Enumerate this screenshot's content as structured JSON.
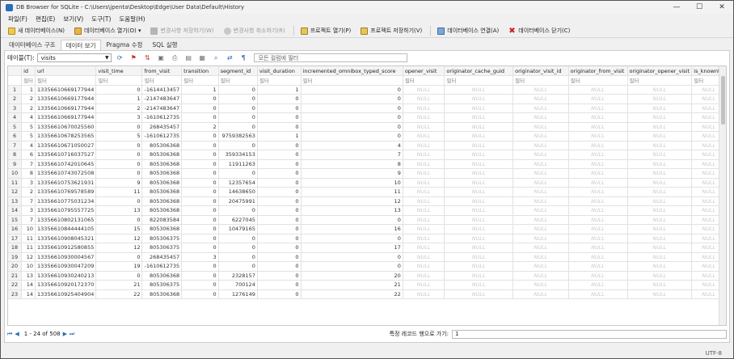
{
  "window": {
    "title": "DB Browser for SQLite - C:\\Users\\jpenta\\Desktop\\Edge\\User Data\\Default\\History",
    "minimize": "—",
    "maximize": "☐",
    "close": "✕"
  },
  "menu": [
    "파일(F)",
    "편집(E)",
    "보기(V)",
    "도구(T)",
    "도움말(H)"
  ],
  "toolbar": {
    "new_db": "새 데이터베이스(N)",
    "open_db": "데이터베이스 열기(O)",
    "write_changes": "변경사항 저장하기(W)",
    "revert_changes": "변경사항 취소하기(R)",
    "open_project": "프로젝트 열기(P)",
    "save_project": "프로젝트 저장하기(V)",
    "attach_db": "데이터베이스 연결(A)",
    "close_db": "데이터베이스 닫기(C)"
  },
  "tabs": [
    "데이터베이스 구조",
    "데이터 보기",
    "Pragma 수정",
    "SQL 실행"
  ],
  "browse": {
    "table_label": "테이블(T):",
    "table_name": "visits",
    "filter_placeholder": "모든 컬럼에 필터"
  },
  "grid": {
    "columns": [
      "id",
      "url",
      "visit_time",
      "from_visit",
      "transition",
      "segment_id",
      "visit_duration",
      "incremented_omnibox_typed_score",
      "opener_visit",
      "originator_cache_guid",
      "originator_visit_id",
      "originator_from_visit",
      "originator_opener_visit",
      "is_knownto"
    ],
    "filter_text": "필터",
    "null_text": "NULL",
    "rows": [
      [
        "1",
        "1",
        "13356610669177944",
        "0",
        "-1614413457",
        "1",
        "0",
        "1",
        "0"
      ],
      [
        "2",
        "2",
        "13356610669177944",
        "1",
        "-2147483647",
        "0",
        "0",
        "0",
        "0"
      ],
      [
        "3",
        "2",
        "13356610669177944",
        "2",
        "-2147483647",
        "0",
        "0",
        "0",
        "0"
      ],
      [
        "4",
        "4",
        "13356610669177944",
        "3",
        "-1610612735",
        "0",
        "0",
        "0",
        "0"
      ],
      [
        "5",
        "5",
        "13356610670025560",
        "0",
        "268435457",
        "2",
        "0",
        "0",
        "0"
      ],
      [
        "6",
        "5",
        "13356610678253565",
        "5",
        "-1610612735",
        "0",
        "9759382563",
        "1",
        "0"
      ],
      [
        "7",
        "4",
        "13356610671050027",
        "0",
        "805306368",
        "0",
        "0",
        "0",
        "4"
      ],
      [
        "8",
        "6",
        "13356610716037527",
        "0",
        "805306368",
        "0",
        "359334153",
        "0",
        "7"
      ],
      [
        "9",
        "7",
        "13356610742010645",
        "0",
        "805306368",
        "0",
        "11911263",
        "0",
        "8"
      ],
      [
        "10",
        "8",
        "13356610743072508",
        "0",
        "805306368",
        "0",
        "0",
        "0",
        "9"
      ],
      [
        "11",
        "3",
        "13356610753621931",
        "9",
        "805306368",
        "0",
        "12357654",
        "0",
        "10"
      ],
      [
        "12",
        "2",
        "13356610769578589",
        "11",
        "805306368",
        "0",
        "14638650",
        "0",
        "11"
      ],
      [
        "13",
        "7",
        "13356610775031234",
        "0",
        "805306368",
        "0",
        "20475991",
        "0",
        "12"
      ],
      [
        "14",
        "3",
        "13356610795557725",
        "13",
        "805306368",
        "0",
        "0",
        "0",
        "13"
      ],
      [
        "15",
        "7",
        "13356610802131065",
        "0",
        "822083584",
        "0",
        "6227045",
        "0",
        "0"
      ],
      [
        "16",
        "10",
        "13356610844444105",
        "15",
        "805306368",
        "0",
        "10479165",
        "0",
        "16"
      ],
      [
        "17",
        "11",
        "13356610908045321",
        "12",
        "805306375",
        "0",
        "0",
        "0",
        "0"
      ],
      [
        "18",
        "11",
        "13356610912580855",
        "12",
        "805306375",
        "0",
        "0",
        "0",
        "17"
      ],
      [
        "19",
        "12",
        "13356610930004567",
        "0",
        "268435457",
        "3",
        "0",
        "0",
        "0"
      ],
      [
        "20",
        "10",
        "13356610930047209",
        "19",
        "-1610612735",
        "0",
        "0",
        "0",
        "0"
      ],
      [
        "21",
        "13",
        "13356610930240213",
        "0",
        "805306368",
        "0",
        "2328157",
        "0",
        "20"
      ],
      [
        "22",
        "14",
        "13356610920172370",
        "21",
        "805306375",
        "0",
        "700124",
        "0",
        "21"
      ],
      [
        "23",
        "14",
        "13356610925404904",
        "22",
        "805306368",
        "0",
        "1276149",
        "0",
        "22"
      ]
    ]
  },
  "nav": {
    "first": "⏮",
    "prev": "◀",
    "status": "1 - 24 of 508",
    "next": "▶",
    "last": "⏭",
    "goto_label": "특정 레코드 행으로 가기:",
    "goto_value": "1"
  },
  "status": {
    "encoding": "UTF-8"
  }
}
